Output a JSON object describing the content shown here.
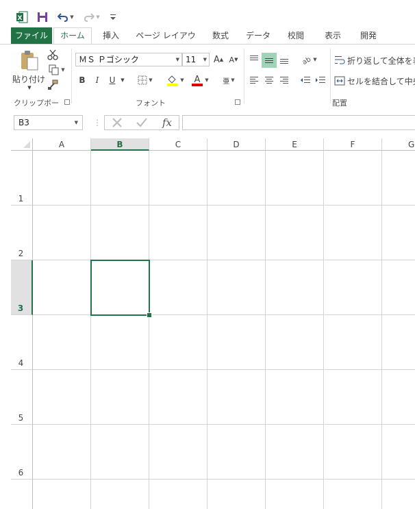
{
  "qat": {
    "excel_icon": "excel-logo",
    "save_icon": "save-icon",
    "undo_icon": "undo-icon",
    "redo_icon": "redo-icon",
    "customize_icon": "customize-qat-icon"
  },
  "tabs": [
    "ファイル",
    "ホーム",
    "挿入",
    "ページ レイアウト",
    "数式",
    "データ",
    "校閲",
    "表示",
    "開発"
  ],
  "active_tab": "ホーム",
  "ribbon": {
    "clipboard": {
      "paste_label": "貼り付け",
      "group_label": "クリップボード"
    },
    "font": {
      "font_name": "ＭＳ Ｐゴシック",
      "font_size": "11",
      "bold": "B",
      "italic": "I",
      "underline": "U",
      "group_label": "フォント"
    },
    "alignment": {
      "wrap_text": "折り返して全体を表",
      "merge_center": "セルを結合して中央",
      "group_label": "配置"
    }
  },
  "formula_bar": {
    "name_box": "B3",
    "fx": "fx",
    "formula": ""
  },
  "sheet": {
    "columns": [
      "A",
      "B",
      "C",
      "D",
      "E",
      "F",
      "G"
    ],
    "rows": [
      "1",
      "2",
      "3",
      "4",
      "5",
      "6"
    ],
    "selected_column": "B",
    "selected_row": "3",
    "active_cell": "B3"
  },
  "colors": {
    "accent": "#217346",
    "header_sel": "#e1e1e1",
    "gridline": "#d4d4d4"
  }
}
